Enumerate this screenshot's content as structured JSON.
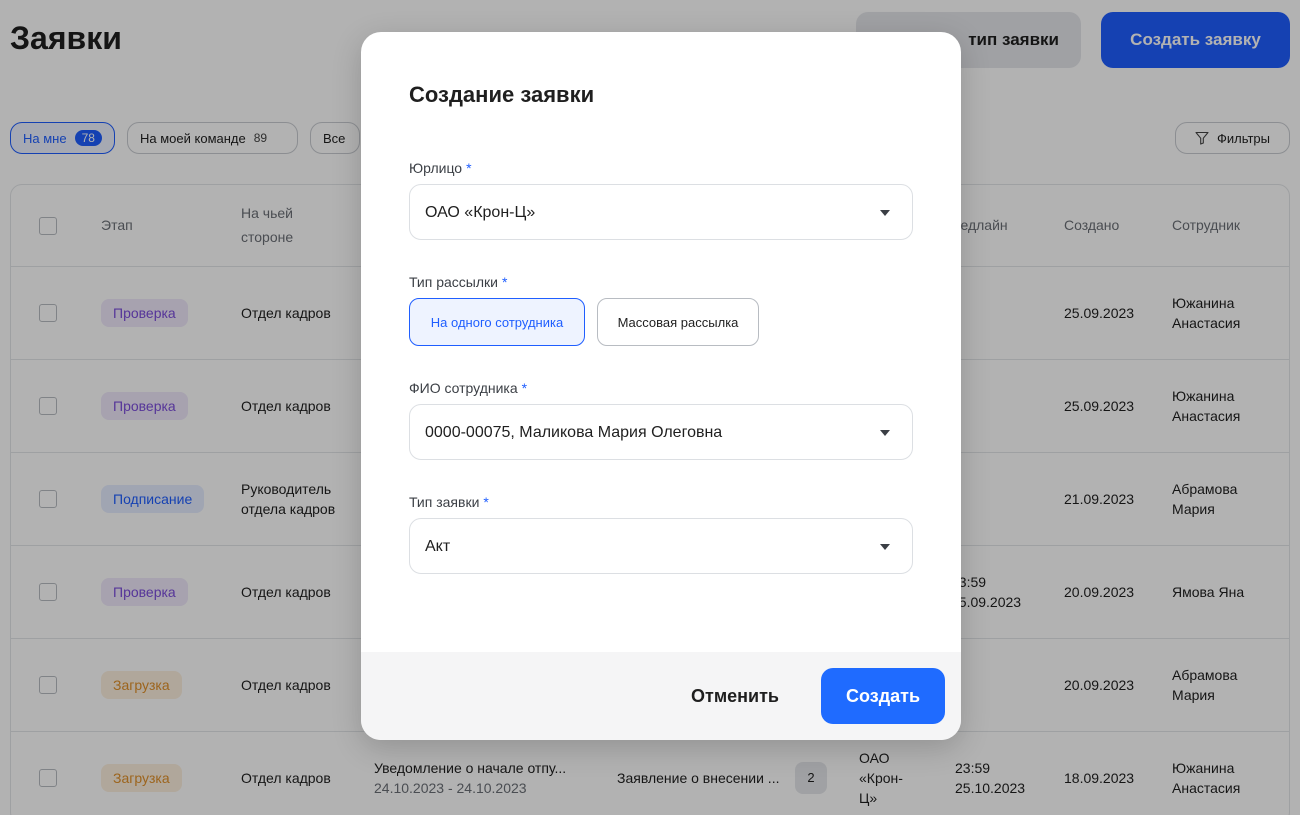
{
  "page": {
    "title": "Заявки",
    "new_type_button": "тип заявки",
    "create_button": "Создать заявку"
  },
  "filters": {
    "chips": [
      {
        "label": "На мне",
        "count": "78"
      },
      {
        "label": "На моей команде",
        "count": "89"
      },
      {
        "label": "Все",
        "count": ""
      }
    ],
    "filters_button": "Фильтры"
  },
  "table": {
    "headers": {
      "stage": "Этап",
      "side_line1": "На чьей",
      "side_line2": "стороне",
      "deadline": "Дедлайн",
      "created": "Создано",
      "employee": "Сотрудник"
    },
    "rows": [
      {
        "stage": "Проверка",
        "side1": "Отдел кадров",
        "side2": "",
        "deadline1": "",
        "deadline2": "",
        "created": "25.09.2023",
        "employee1": "Южанина",
        "employee2": "Анастасия"
      },
      {
        "stage": "Проверка",
        "side1": "Отдел кадров",
        "side2": "",
        "deadline1": "",
        "deadline2": "",
        "created": "25.09.2023",
        "employee1": "Южанина",
        "employee2": "Анастасия"
      },
      {
        "stage": "Подписание",
        "side1": "Руководитель",
        "side2": "отдела кадров",
        "deadline1": "",
        "deadline2": "",
        "created": "21.09.2023",
        "employee1": "Абрамова",
        "employee2": "Мария"
      },
      {
        "stage": "Проверка",
        "side1": "Отдел кадров",
        "side2": "",
        "deadline1": "23:59",
        "deadline2": "25.09.2023",
        "created": "20.09.2023",
        "employee1": "Ямова Яна",
        "employee2": ""
      },
      {
        "stage": "Загрузка",
        "side1": "Отдел кадров",
        "side2": "",
        "deadline1": "",
        "deadline2": "",
        "created": "20.09.2023",
        "employee1": "Абрамова",
        "employee2": "Мария"
      },
      {
        "stage": "Загрузка",
        "side1": "Отдел кадров",
        "side2": "",
        "doc1": "Уведомление о начале отпу...",
        "doc2": "24.10.2023 - 24.10.2023",
        "statement": "Заявление о внесении ...",
        "count": "2",
        "org1": "ОАО",
        "org2": "«Крон-",
        "org3": "Ц»",
        "deadline1": "23:59",
        "deadline2": "25.10.2023",
        "created": "18.09.2023",
        "employee1": "Южанина",
        "employee2": "Анастасия"
      }
    ]
  },
  "modal": {
    "title": "Создание заявки",
    "required_mark": "*",
    "legal_entity": {
      "label": "Юрлицо",
      "value": "ОАО «Крон-Ц»"
    },
    "mailing_type": {
      "label": "Тип рассылки",
      "options": [
        "На одного сотрудника",
        "Массовая рассылка"
      ],
      "selected": "На одного сотрудника"
    },
    "employee": {
      "label": "ФИО сотрудника",
      "value": "0000-00075, Маликова Мария Олеговна"
    },
    "request_type": {
      "label": "Тип заявки",
      "value": "Акт"
    },
    "cancel_button": "Отменить",
    "submit_button": "Создать"
  },
  "colors": {
    "accent": "#1f5eff",
    "badge_check": "#7c4ddb",
    "badge_sign": "#1f5eff",
    "badge_upload": "#e0902a"
  }
}
